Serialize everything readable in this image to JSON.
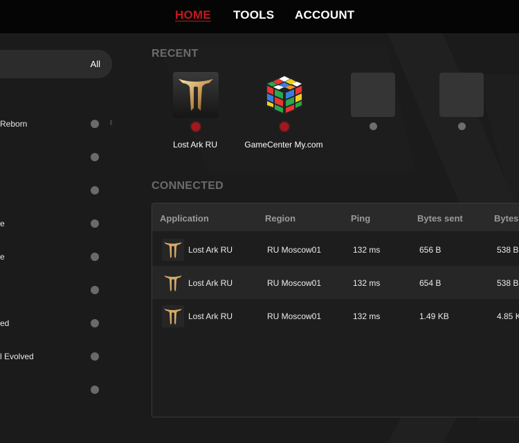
{
  "nav": {
    "home": "HOME",
    "tools": "TOOLS",
    "account": "ACCOUNT"
  },
  "sidebar": {
    "filter": "All",
    "items": [
      {
        "label": "Reborn"
      },
      {
        "label": ""
      },
      {
        "label": ""
      },
      {
        "label": "e"
      },
      {
        "label": "e"
      },
      {
        "label": ""
      },
      {
        "label": "ed"
      },
      {
        "label": "l Evolved"
      },
      {
        "label": ""
      }
    ]
  },
  "recent": {
    "title": "RECENT",
    "items": [
      {
        "label": "Lost Ark RU",
        "icon": "lost-ark-icon",
        "status": "active"
      },
      {
        "label": "GameCenter My.com",
        "icon": "rubiks-cube-icon",
        "status": "active"
      },
      {
        "label": "",
        "icon": "empty-slot",
        "status": "inactive"
      },
      {
        "label": "",
        "icon": "empty-slot",
        "status": "inactive"
      }
    ]
  },
  "connected": {
    "title": "CONNECTED",
    "columns": [
      "Application",
      "Region",
      "Ping",
      "Bytes sent",
      "Bytes"
    ],
    "rows": [
      {
        "app": "Lost Ark RU",
        "region": "RU Moscow01",
        "ping": "132 ms",
        "sent": "656 B",
        "recv": "538 B"
      },
      {
        "app": "Lost Ark RU",
        "region": "RU Moscow01",
        "ping": "132 ms",
        "sent": "654 B",
        "recv": "538 B"
      },
      {
        "app": "Lost Ark RU",
        "region": "RU Moscow01",
        "ping": "132 ms",
        "sent": "1.49 KB",
        "recv": "4.85 K"
      }
    ]
  },
  "colors": {
    "accent": "#c0191f",
    "active_dot": "#a5171c",
    "inactive_dot": "#6e6e6e",
    "background": "#1b1b1b"
  }
}
